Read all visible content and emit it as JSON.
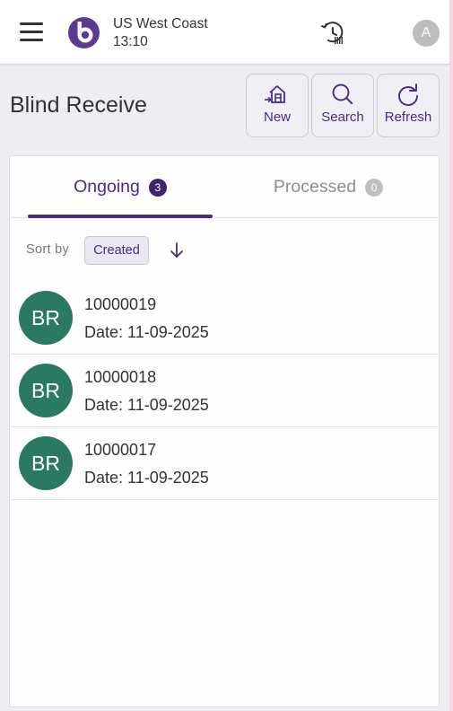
{
  "header": {
    "location_name": "US West Coast",
    "time": "13:10",
    "avatar_initial": "A",
    "icons": [
      "menu-icon",
      "app-logo",
      "history-icon",
      "avatar"
    ]
  },
  "page": {
    "title": "Blind Receive"
  },
  "toolbar": {
    "new_label": "New",
    "search_label": "Search",
    "refresh_label": "Refresh"
  },
  "tabs": [
    {
      "label": "Ongoing",
      "count": "3",
      "active": true
    },
    {
      "label": "Processed",
      "count": "0",
      "active": false
    }
  ],
  "sort": {
    "label": "Sort by",
    "field": "Created",
    "direction": "descending"
  },
  "items": [
    {
      "initials": "BR",
      "number": "10000019",
      "date": "Date: 11-09-2025"
    },
    {
      "initials": "BR",
      "number": "10000018",
      "date": "Date: 11-09-2025"
    },
    {
      "initials": "BR",
      "number": "10000017",
      "date": "Date: 11-09-2025"
    }
  ],
  "colors": {
    "accent": "#4a2c82",
    "avatar_green": "#2a7a63",
    "badge_dark": "#3b2470",
    "badge_grey": "#c0c0c0"
  }
}
